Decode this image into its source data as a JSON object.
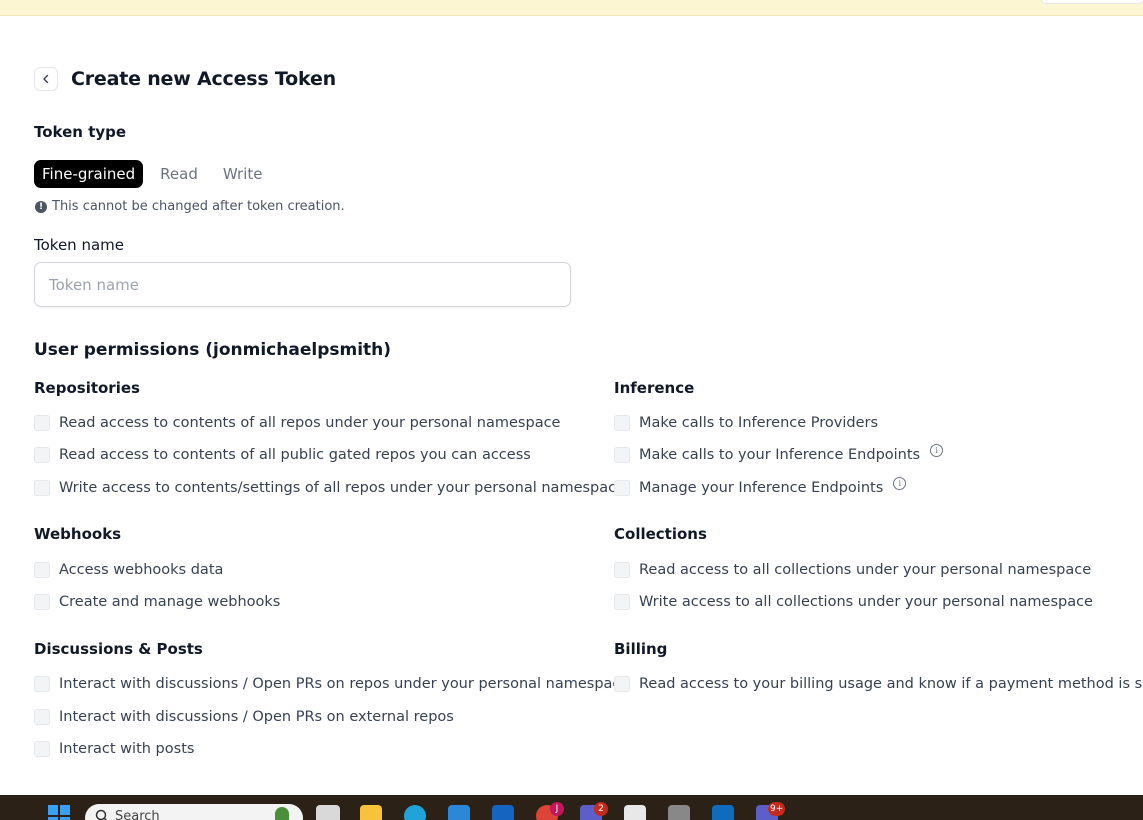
{
  "header": {
    "title": "Create new Access Token"
  },
  "token_type": {
    "label": "Token type",
    "tabs": [
      {
        "label": "Fine-grained",
        "active": true
      },
      {
        "label": "Read",
        "active": false
      },
      {
        "label": "Write",
        "active": false
      }
    ],
    "note": "This cannot be changed after token creation."
  },
  "token_name": {
    "label": "Token name",
    "placeholder": "Token name",
    "value": ""
  },
  "permissions": {
    "title": "User permissions (jonmichaelpsmith)",
    "repositories": {
      "heading": "Repositories",
      "items": [
        "Read access to contents of all repos under your personal namespace",
        "Read access to contents of all public gated repos you can access",
        "Write access to contents/settings of all repos under your personal namespace"
      ]
    },
    "inference": {
      "heading": "Inference",
      "items": [
        "Make calls to Inference Providers",
        "Make calls to your Inference Endpoints",
        "Manage your Inference Endpoints"
      ]
    },
    "webhooks": {
      "heading": "Webhooks",
      "items": [
        "Access webhooks data",
        "Create and manage webhooks"
      ]
    },
    "collections": {
      "heading": "Collections",
      "items": [
        "Read access to all collections under your personal namespace",
        "Write access to all collections under your personal namespace"
      ]
    },
    "discussions": {
      "heading": "Discussions & Posts",
      "items": [
        "Interact with discussions / Open PRs on repos under your personal namespace",
        "Interact with discussions / Open PRs on external repos",
        "Interact with posts"
      ]
    },
    "billing": {
      "heading": "Billing",
      "items": [
        "Read access to your billing usage and know if a payment method is set"
      ]
    }
  },
  "taskbar": {
    "search_placeholder": "Search",
    "badges": {
      "chrome": "J",
      "teams": "2",
      "teams_classic": "9+"
    }
  },
  "colors": {
    "accent_active_tab": "#000000",
    "banner": "#fdf6d3",
    "taskbar": "#2b2116"
  }
}
